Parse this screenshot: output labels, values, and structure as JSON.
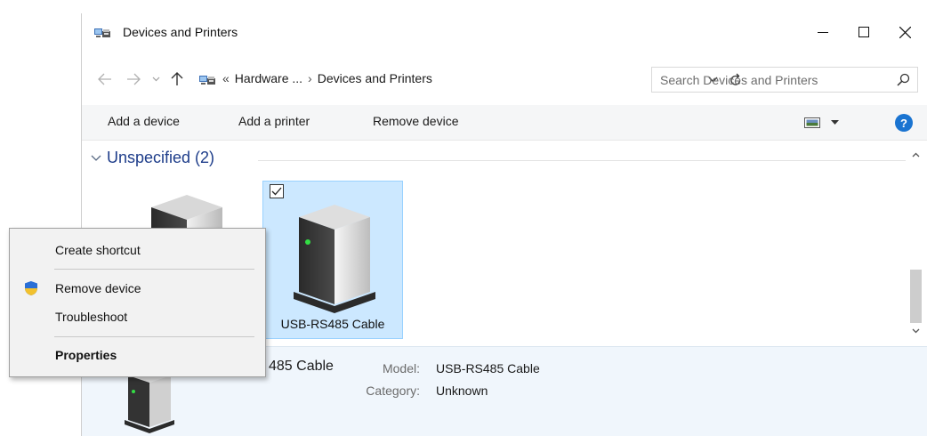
{
  "window": {
    "title": "Devices and Printers",
    "icon": "devices-printers-icon",
    "controls": {
      "minimize": "minimize-icon",
      "maximize": "maximize-icon",
      "close": "close-icon"
    }
  },
  "address_bar": {
    "overflow": "«",
    "crumbs": [
      "Hardware ...",
      "Devices and Printers"
    ],
    "separator": "›",
    "search_placeholder": "Search Devices and Printers"
  },
  "command_bar": {
    "add_device": "Add a device",
    "add_printer": "Add a printer",
    "remove_device": "Remove device",
    "help": "?"
  },
  "group": {
    "label": "Unspecified (2)"
  },
  "devices": [
    {
      "label": "",
      "selected": false
    },
    {
      "label": "USB-RS485 Cable",
      "selected": true,
      "checked": true
    }
  ],
  "details": {
    "name": "485 Cable",
    "model_key": "Model:",
    "model_value": "USB-RS485 Cable",
    "category_key": "Category:",
    "category_value": "Unknown"
  },
  "context_menu": {
    "items": [
      {
        "label": "Create shortcut"
      },
      {
        "label": "Remove device",
        "icon": "uac-shield-icon"
      },
      {
        "label": "Troubleshoot"
      },
      {
        "label": "Properties",
        "bold": true
      }
    ]
  },
  "colors": {
    "selection_fill": "#cce8ff",
    "selection_border": "#99d1ff",
    "group_label": "#1e3d8a",
    "details_bg": "#f0f6fc",
    "help_blue": "#1a74d1"
  }
}
